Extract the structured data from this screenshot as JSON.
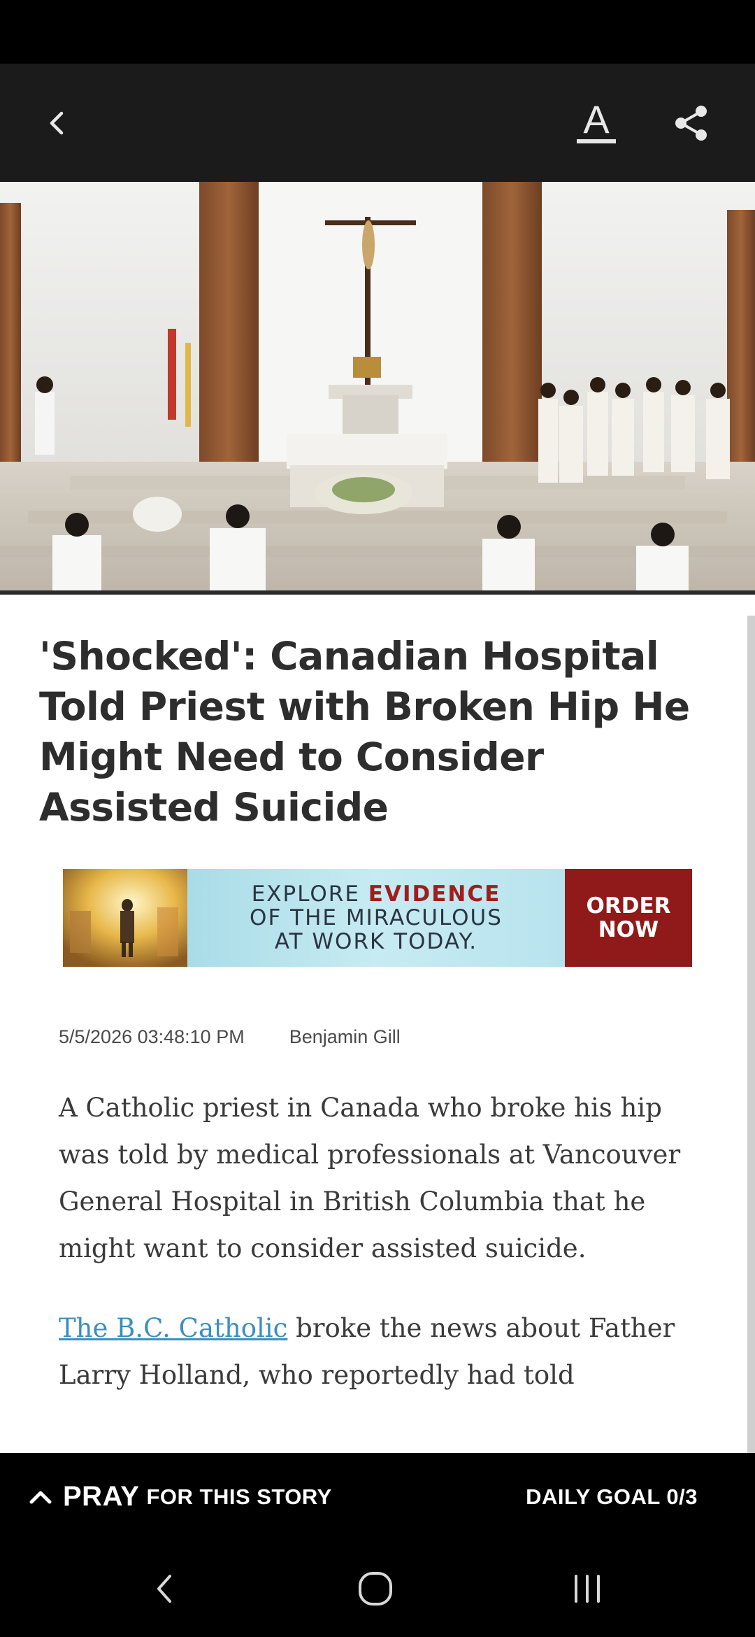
{
  "icons": {
    "back": "chevron-left-icon",
    "font_size": "text-size-icon",
    "share": "share-icon",
    "pray_expand": "chevron-up-icon",
    "nav_back": "nav-back-icon",
    "nav_home": "nav-home-icon",
    "nav_recents": "nav-recents-icon"
  },
  "toolbar": {
    "font_size_glyph": "A"
  },
  "article": {
    "title": "'Shocked': Canadian Hospital Told Priest with Broken Hip He Might Need to Consider Assisted Suicide",
    "date": "5/5/2026 03:48:10 PM",
    "author": "Benjamin Gill",
    "paragraph_1": "A Catholic priest in Canada who broke his hip was told by medical professionals at Vancouver General Hospital in British Columbia that he might want to consider assisted suicide.",
    "paragraph_2_link": "The B.C. Catholic",
    "paragraph_2_rest": " broke the news about Father Larry Holland, who reportedly had told"
  },
  "ad": {
    "line1_prefix": "EXPLORE ",
    "line1_highlight": "EVIDENCE",
    "line2": "OF THE MIRACULOUS",
    "line3": "AT WORK TODAY.",
    "cta_line1": "ORDER",
    "cta_line2": "NOW"
  },
  "pray_bar": {
    "pray_word": "PRAY",
    "pray_rest": "FOR THIS STORY",
    "daily_goal": "DAILY GOAL 0/3"
  },
  "colors": {
    "toolbar_bg": "#1b1b1b",
    "ad_cta_bg": "#8f1a19",
    "link": "#3a8fc0",
    "title_text": "#2d2d2d"
  }
}
